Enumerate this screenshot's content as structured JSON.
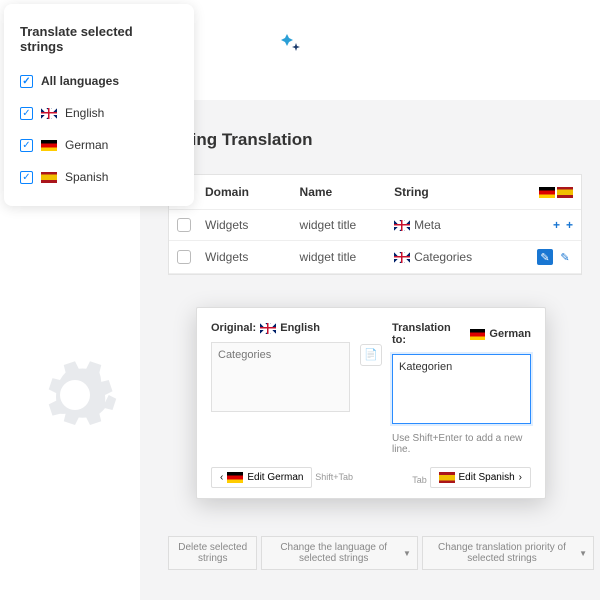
{
  "sidebar": {
    "title": "Translate selected strings",
    "all_label": "All languages",
    "langs": [
      {
        "label": "English",
        "flag": "uk"
      },
      {
        "label": "German",
        "flag": "de"
      },
      {
        "label": "Spanish",
        "flag": "es"
      }
    ]
  },
  "main": {
    "title": "String Translation",
    "cols": {
      "domain": "Domain",
      "name": "Name",
      "string": "String"
    },
    "rows": [
      {
        "domain": "Widgets",
        "name": "widget title",
        "string": "Meta",
        "status": "plus"
      },
      {
        "domain": "Widgets",
        "name": "widget title",
        "string": "Categories",
        "status": "pen"
      }
    ]
  },
  "popover": {
    "original_label": "Original:",
    "original_lang": "English",
    "original_value": "Categories",
    "trans_label": "Translation to:",
    "trans_lang": "German",
    "trans_value": "Kategorien",
    "hint": "Use Shift+Enter to add a new line.",
    "prev": "Edit German",
    "prev_kbd": "Shift+Tab",
    "next": "Edit Spanish",
    "next_kbd": "Tab"
  },
  "actions": {
    "delete": "Delete selected strings",
    "change_lang": "Change the language of selected strings",
    "change_priority": "Change translation priority of selected strings"
  }
}
